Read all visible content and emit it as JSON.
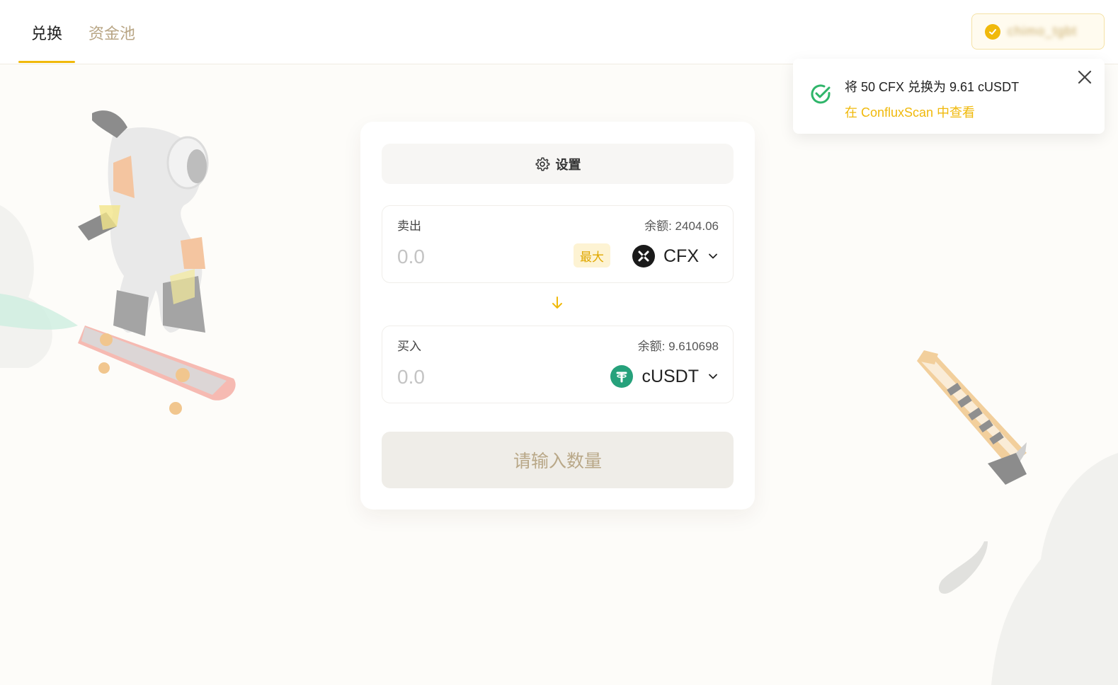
{
  "header": {
    "tabs": [
      {
        "label": "兑换",
        "active": true
      },
      {
        "label": "资金池",
        "active": false
      }
    ],
    "wallet": {
      "address": "chimo_tgbt"
    }
  },
  "toast": {
    "message": "将 50 CFX 兑换为 9.61 cUSDT",
    "link": "在 ConfluxScan 中查看"
  },
  "swap": {
    "settings_label": "设置",
    "sell": {
      "label": "卖出",
      "balance": "余额: 2404.06",
      "placeholder": "0.0",
      "max_label": "最大",
      "token": "CFX"
    },
    "buy": {
      "label": "买入",
      "balance": "余额: 9.610698",
      "placeholder": "0.0",
      "token": "cUSDT"
    },
    "submit_label": "请输入数量"
  },
  "colors": {
    "accent": "#f0b90b",
    "success": "#2fb56a",
    "usdt": "#26a17b"
  }
}
